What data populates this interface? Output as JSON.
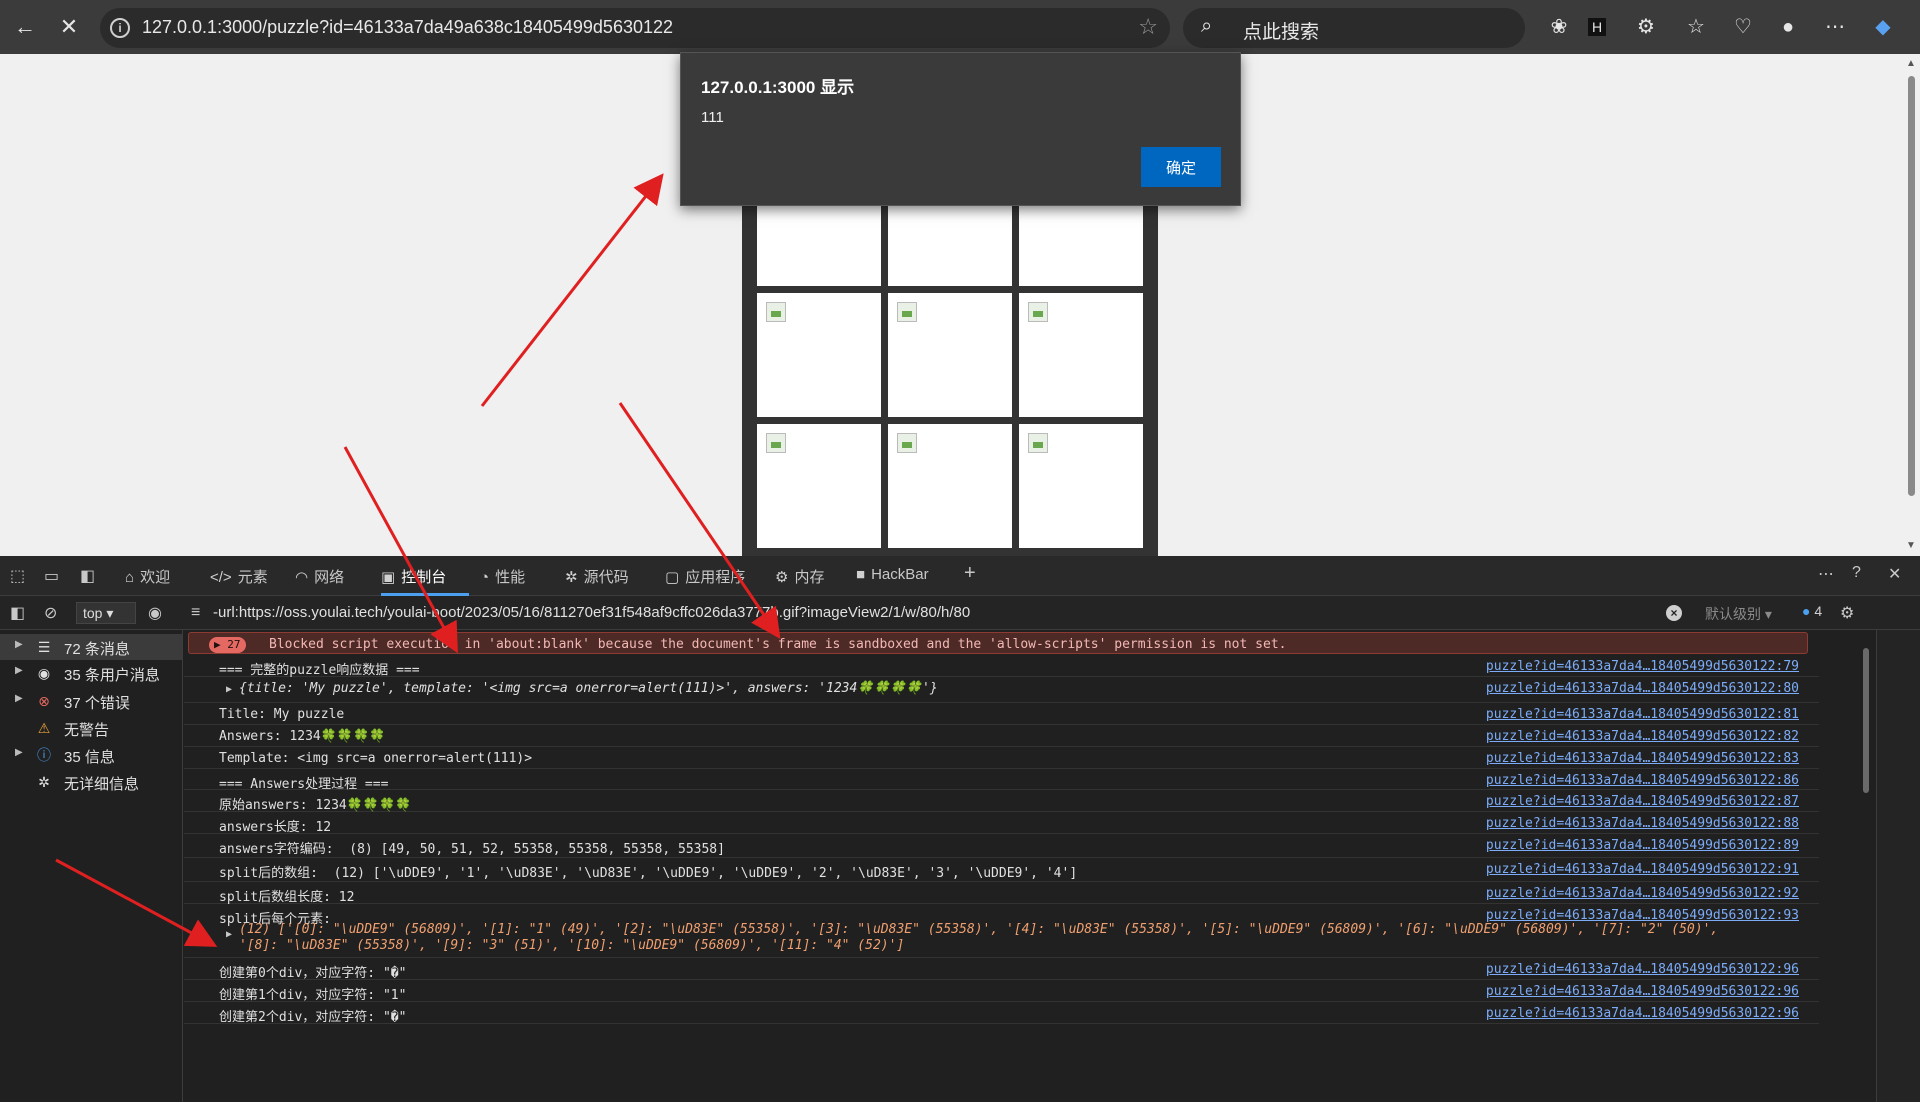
{
  "browser": {
    "url": "127.0.0.1:3000/puzzle?id=46133a7da49a638c18405499d5630122",
    "search_placeholder": "点此搜索"
  },
  "alert": {
    "title": "127.0.0.1:3000 显示",
    "message": "111",
    "ok_label": "确定"
  },
  "devtools": {
    "tabs": [
      {
        "icon": "home-icon",
        "label": "欢迎"
      },
      {
        "icon": "code-icon",
        "label": "元素"
      },
      {
        "icon": "wifi-icon",
        "label": "网络"
      },
      {
        "icon": "console-icon",
        "label": "控制台"
      },
      {
        "icon": "gauge-icon",
        "label": "性能"
      },
      {
        "icon": "bug-icon",
        "label": "源代码"
      },
      {
        "icon": "window-icon",
        "label": "应用程序"
      },
      {
        "icon": "memory-icon",
        "label": "内存"
      },
      {
        "icon": "hackbar-icon",
        "label": "HackBar"
      }
    ],
    "context": "top",
    "filter_text": "-url:https://oss.youlai.tech/youlai-boot/2023/05/16/811270ef31f548af9cffc026da3777b.gif?imageView2/1/w/80/h/80",
    "level": "默认级别",
    "issues_count": "4"
  },
  "sidebar": {
    "items": [
      {
        "label": "72 条消息",
        "icon": "list-icon"
      },
      {
        "label": "35 条用户消息",
        "icon": "user-icon"
      },
      {
        "label": "37 个错误",
        "icon": "error-icon"
      },
      {
        "label": "无警告",
        "icon": "warning-icon"
      },
      {
        "label": "35 信息",
        "icon": "info-icon"
      },
      {
        "label": "无详细信息",
        "icon": "verbose-icon"
      }
    ]
  },
  "console": {
    "error_count": "27",
    "error_text": "Blocked script execution in 'about:blank' because the document's frame is sandboxed and the 'allow-scripts' permission is not set.",
    "rows": [
      {
        "msg": "=== 完整的puzzle响应数据 ===",
        "src": "puzzle?id=46133a7da4…18405499d5630122:79"
      },
      {
        "msg": "{title: 'My puzzle', template: '<img src=a onerror=alert(111)>', answers: '1234🍀🍀🍀🍀'}",
        "src": "puzzle?id=46133a7da4…18405499d5630122:80"
      },
      {
        "msg": "Title: My puzzle",
        "src": "puzzle?id=46133a7da4…18405499d5630122:81"
      },
      {
        "msg": "Answers: 1234🍀🍀🍀🍀",
        "src": "puzzle?id=46133a7da4…18405499d5630122:82"
      },
      {
        "msg": "Template: <img src=a onerror=alert(111)>",
        "src": "puzzle?id=46133a7da4…18405499d5630122:83"
      },
      {
        "msg": "=== Answers处理过程 ===",
        "src": "puzzle?id=46133a7da4…18405499d5630122:86"
      },
      {
        "msg": "原始answers: 1234🍀🍀🍀🍀",
        "src": "puzzle?id=46133a7da4…18405499d5630122:87"
      },
      {
        "msg": "answers长度: 12",
        "src": "puzzle?id=46133a7da4…18405499d5630122:88"
      },
      {
        "msg": "answers字符编码:  (8) [49, 50, 51, 52, 55358, 55358, 55358, 55358]",
        "src": "puzzle?id=46133a7da4…18405499d5630122:89"
      },
      {
        "msg": "split后的数组:  (12) ['\\uDDE9', '1', '\\uD83E', '\\uD83E', '\\uDDE9', '\\uDDE9', '2', '\\uD83E', '3', '\\uDDE9', '4']",
        "src": "puzzle?id=46133a7da4…18405499d5630122:91"
      },
      {
        "msg": "split后数组长度: 12",
        "src": "puzzle?id=46133a7da4…18405499d5630122:92"
      },
      {
        "msg": "split后每个元素:",
        "src": "puzzle?id=46133a7da4…18405499d5630122:93"
      },
      {
        "msg": "(12) ['[0]: \"\\uDDE9\" (56809)', '[1]: \"1\" (49)', '[2]: \"\\uD83E\" (55358)', '[3]: \"\\uD83E\" (55358)', '[4]: \"\\uD83E\" (55358)', '[5]: \"\\uDDE9\" (56809)', '[6]: \"\\uDDE9\" (56809)', '[7]: \"2\" (50)',",
        "src": ""
      },
      {
        "msg": "'[8]: \"\\uD83E\" (55358)', '[9]: \"3\" (51)', '[10]: \"\\uDDE9\" (56809)', '[11]: \"4\" (52)']",
        "src": ""
      },
      {
        "msg": "创建第0个div，对应字符: \"�\"",
        "src": "puzzle?id=46133a7da4…18405499d5630122:96"
      },
      {
        "msg": "创建第1个div，对应字符: \"1\"",
        "src": "puzzle?id=46133a7da4…18405499d5630122:96"
      },
      {
        "msg": "创建第2个div，对应字符: \"�\"",
        "src": "puzzle?id=46133a7da4…18405499d5630122:96"
      }
    ]
  },
  "colors": {
    "accent": "#4ba0f0",
    "alert_button": "#0067c0",
    "error_badge": "#e46962",
    "annotation_arrow": "#e02020"
  }
}
